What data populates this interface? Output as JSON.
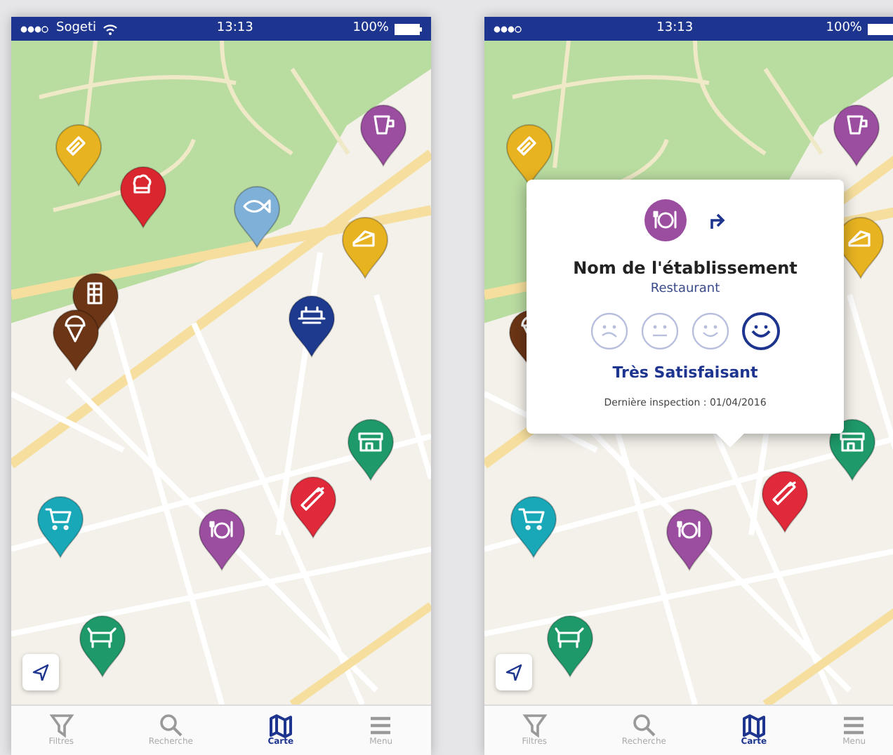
{
  "screens": [
    {
      "status_bar": {
        "carrier": "Sogeti",
        "time": "13:13",
        "battery": "100%"
      },
      "pins": [
        {
          "kind": "bread",
          "color": "#e8b321"
        },
        {
          "kind": "chef",
          "color": "#d9262f"
        },
        {
          "kind": "cup",
          "color": "#9b4ea0"
        },
        {
          "kind": "fish",
          "color": "#7fb0d8"
        },
        {
          "kind": "cheese",
          "color": "#e8b321"
        },
        {
          "kind": "chocolate",
          "color": "#6b3516"
        },
        {
          "kind": "icecream",
          "color": "#6b3516"
        },
        {
          "kind": "catering",
          "color": "#1d3a8f"
        },
        {
          "kind": "shop",
          "color": "#1e9a6a"
        },
        {
          "kind": "knife",
          "color": "#e02a3a"
        },
        {
          "kind": "cart",
          "color": "#19a8b8"
        },
        {
          "kind": "plate",
          "color": "#9b4ea0"
        },
        {
          "kind": "cow",
          "color": "#1e9a6a"
        }
      ],
      "tabs": [
        {
          "kind": "filter",
          "label": "Filtres",
          "selected": false
        },
        {
          "kind": "search",
          "label": "Recherche",
          "selected": false
        },
        {
          "kind": "map",
          "label": "Carte",
          "selected": true
        },
        {
          "kind": "menu",
          "label": "Menu",
          "selected": false
        }
      ]
    },
    {
      "status_bar": {
        "time": "13:13",
        "battery": "100%"
      },
      "pins": [
        {
          "kind": "bread",
          "color": "#e8b321"
        },
        {
          "kind": "cup",
          "color": "#9b4ea0"
        },
        {
          "kind": "cheese",
          "color": "#e8b321"
        },
        {
          "kind": "icecream",
          "color": "#6b3516"
        },
        {
          "kind": "shop",
          "color": "#1e9a6a"
        },
        {
          "kind": "knife",
          "color": "#e02a3a"
        },
        {
          "kind": "cart",
          "color": "#19a8b8"
        },
        {
          "kind": "plate",
          "color": "#9b4ea0"
        },
        {
          "kind": "cow",
          "color": "#1e9a6a"
        }
      ],
      "popup": {
        "icon": {
          "kind": "plate",
          "color": "#9b4ea0"
        },
        "title": "Nom de l'établissement",
        "category": "Restaurant",
        "ratings": [
          {
            "kind": "sad",
            "selected": false
          },
          {
            "kind": "neutral",
            "selected": false
          },
          {
            "kind": "smile",
            "selected": false
          },
          {
            "kind": "happy",
            "selected": true
          }
        ],
        "rating_label": "Très Satisfaisant",
        "inspection": "Dernière inspection : 01/04/2016"
      },
      "tabs": [
        {
          "kind": "filter",
          "label": "Filtres",
          "selected": false
        },
        {
          "kind": "search",
          "label": "Recherche",
          "selected": false
        },
        {
          "kind": "map",
          "label": "Carte",
          "selected": true
        },
        {
          "kind": "menu",
          "label": "Menu",
          "selected": false
        }
      ]
    }
  ]
}
